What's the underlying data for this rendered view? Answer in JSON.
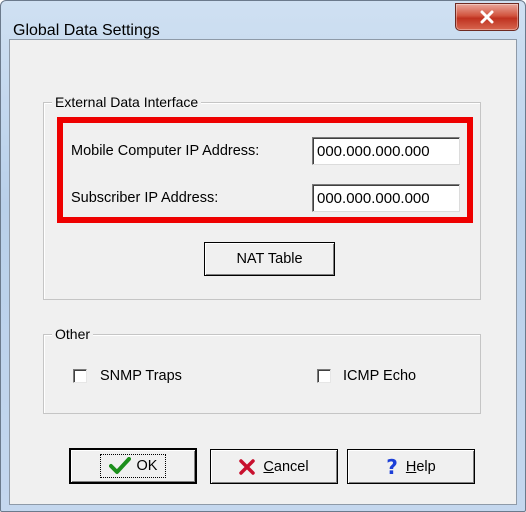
{
  "window": {
    "title": "Global Data Settings",
    "close_glyph": "✕"
  },
  "external_group": {
    "title": "External Data Interface",
    "mobile_ip_label": "Mobile Computer IP Address:",
    "mobile_ip_value": "000.000.000.000",
    "subscriber_ip_label": "Subscriber IP Address:",
    "subscriber_ip_value": "000.000.000.000",
    "nat_button_label": "NAT Table",
    "highlight_color": "#ee0000"
  },
  "other_group": {
    "title": "Other",
    "snmp_label": "SNMP Traps",
    "snmp_checked": false,
    "icmp_label": "ICMP Echo",
    "icmp_checked": false
  },
  "buttons": {
    "ok_label": "OK",
    "ok_icon": "checkmark-icon",
    "cancel_label": "Cancel",
    "cancel_icon": "x-icon",
    "help_label": "Help",
    "help_icon": "question-mark-icon"
  }
}
